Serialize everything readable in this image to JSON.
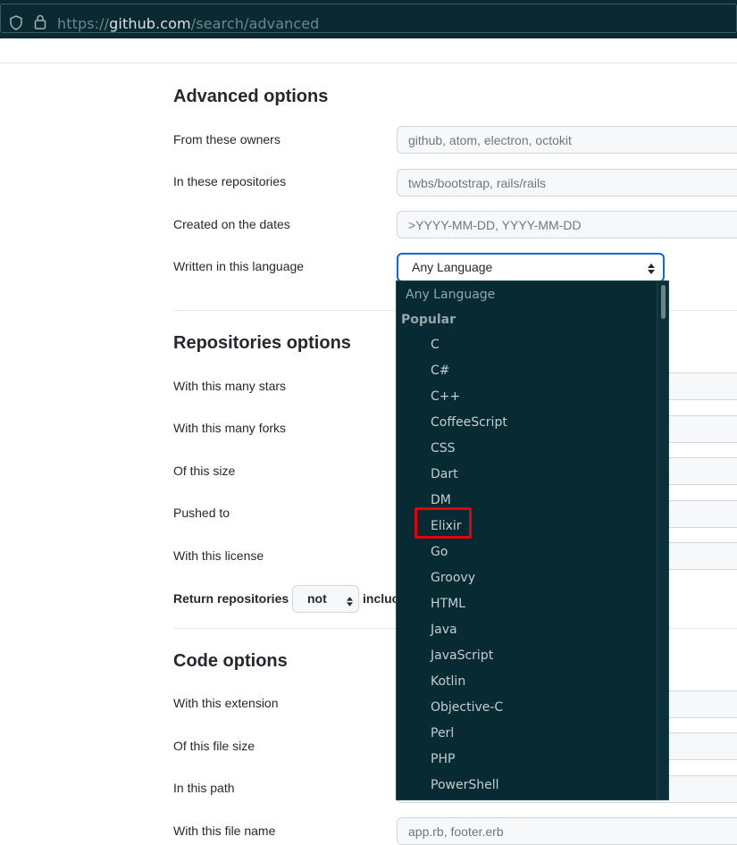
{
  "browser": {
    "url_scheme": "https://",
    "url_host": "github.com",
    "url_path": "/search/advanced"
  },
  "advanced": {
    "heading": "Advanced options",
    "owners_label": "From these owners",
    "owners_placeholder": "github, atom, electron, octokit",
    "repos_label": "In these repositories",
    "repos_placeholder": "twbs/bootstrap, rails/rails",
    "dates_label": "Created on the dates",
    "dates_placeholder": ">YYYY-MM-DD, YYYY-MM-DD",
    "language_label": "Written in this language",
    "language_value": "Any Language"
  },
  "repositories": {
    "heading": "Repositories options",
    "stars_label": "With this many stars",
    "forks_label": "With this many forks",
    "size_label": "Of this size",
    "pushed_label": "Pushed to",
    "license_label": "With this license",
    "return_label": "Return repositories",
    "return_select": "not",
    "return_tail": "incluc"
  },
  "code": {
    "heading": "Code options",
    "extension_label": "With this extension",
    "filesize_label": "Of this file size",
    "path_label": "In this path",
    "filename_label": "With this file name",
    "filename_placeholder": "app.rb, footer.erb"
  },
  "dropdown": {
    "any": "Any Language",
    "group": "Popular",
    "items": [
      "C",
      "C#",
      "C++",
      "CoffeeScript",
      "CSS",
      "Dart",
      "DM",
      "Elixir",
      "Go",
      "Groovy",
      "HTML",
      "Java",
      "JavaScript",
      "Kotlin",
      "Objective-C",
      "Perl",
      "PHP",
      "PowerShell"
    ],
    "highlighted": "Elixir"
  },
  "colors": {
    "accent": "#0969da",
    "dropdown_bg": "#082a33",
    "highlight": "#e3000b"
  }
}
